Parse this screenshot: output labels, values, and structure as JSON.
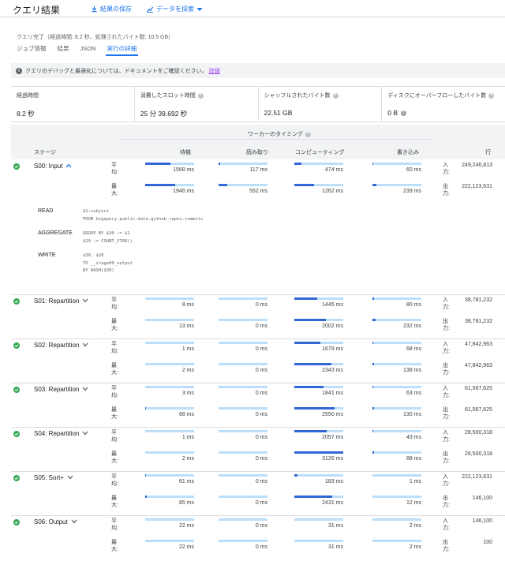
{
  "header": {
    "title": "クエリ結果",
    "save_label": "結果の保存",
    "explore_label": "データを探索"
  },
  "status": "クエリ完了（経過時間: 8.2 秒、処理されたバイト数: 10.5 GB）",
  "tabs": [
    {
      "label": "ジョブ情報"
    },
    {
      "label": "結果"
    },
    {
      "label": "JSON"
    },
    {
      "label": "実行の詳細",
      "active": true
    }
  ],
  "info": {
    "text": "クエリのデバッグと最適化については、ドキュメントをご確認ください。",
    "link": "詳細"
  },
  "metrics": [
    {
      "label": "経過時間",
      "value": "8.2 秒"
    },
    {
      "label": "消費したスロット時間",
      "value": "25 分 39.692 秒"
    },
    {
      "label": "シャッフルされたバイト数",
      "value": "22.51 GB"
    },
    {
      "label": "ディスクにオーバーフローしたバイト数",
      "value": "0 B"
    }
  ],
  "timing": {
    "title": "ワーカーのタイミング",
    "col_stage": "ステージ",
    "col_wait": "待機",
    "col_read": "読み取り",
    "col_compute": "コンピューティング",
    "col_write": "書き込み",
    "col_rows": "行",
    "avg_label": "平均:",
    "max_label": "最大:",
    "in_label": "入力:",
    "out_label": "出力:"
  },
  "stages": [
    {
      "name": "S00: Input",
      "expanded": true,
      "avg": {
        "wait": "1568 ms",
        "read": "117 ms",
        "compute": "474 ms",
        "write": "60 ms"
      },
      "max": {
        "wait": "1946 ms",
        "read": "552 ms",
        "compute": "1262 ms",
        "write": "239 ms"
      },
      "avg_fill": {
        "wait": 0.51,
        "read": 0.04,
        "compute": 0.15,
        "write": 0.02
      },
      "max_fill": {
        "wait": 0.62,
        "read": 0.18,
        "compute": 0.4,
        "write": 0.08
      },
      "rows_in": "249,246,813",
      "rows_out": "222,123,631",
      "steps": [
        {
          "label": "READ",
          "detail": "$1:subject\nFROM bigquery-public-data.github_repos.commits"
        },
        {
          "label": "AGGREGATE",
          "detail": "GROUP BY $30 := $1\n$20 := COUNT_STAR()"
        },
        {
          "label": "WRITE",
          "detail": "$30, $20\nTO __stage00_output\nBY HASH($30)"
        }
      ]
    },
    {
      "name": "S01: Repartition",
      "avg": {
        "wait": "8 ms",
        "read": "0 ms",
        "compute": "1445 ms",
        "write": "80 ms"
      },
      "max": {
        "wait": "13 ms",
        "read": "0 ms",
        "compute": "2002 ms",
        "write": "232 ms"
      },
      "avg_fill": {
        "wait": 0.0,
        "read": 0.0,
        "compute": 0.46,
        "write": 0.03
      },
      "max_fill": {
        "wait": 0.0,
        "read": 0.0,
        "compute": 0.64,
        "write": 0.07
      },
      "rows_in": "38,781,232",
      "rows_out": "38,781,232"
    },
    {
      "name": "S02: Repartition",
      "avg": {
        "wait": "1 ms",
        "read": "0 ms",
        "compute": "1679 ms",
        "write": "68 ms"
      },
      "max": {
        "wait": "2 ms",
        "read": "0 ms",
        "compute": "2343 ms",
        "write": "138 ms"
      },
      "avg_fill": {
        "wait": 0.0,
        "read": 0.0,
        "compute": 0.54,
        "write": 0.02
      },
      "max_fill": {
        "wait": 0.0,
        "read": 0.0,
        "compute": 0.75,
        "write": 0.04
      },
      "rows_in": "47,842,963",
      "rows_out": "47,842,963"
    },
    {
      "name": "S03: Repartition",
      "avg": {
        "wait": "3 ms",
        "read": "0 ms",
        "compute": "1841 ms",
        "write": "63 ms"
      },
      "max": {
        "wait": "68 ms",
        "read": "0 ms",
        "compute": "2550 ms",
        "write": "130 ms"
      },
      "avg_fill": {
        "wait": 0.0,
        "read": 0.0,
        "compute": 0.59,
        "write": 0.02
      },
      "max_fill": {
        "wait": 0.02,
        "read": 0.0,
        "compute": 0.82,
        "write": 0.04
      },
      "rows_in": "61,567,625",
      "rows_out": "61,567,625"
    },
    {
      "name": "S04: Repartition",
      "avg": {
        "wait": "1 ms",
        "read": "0 ms",
        "compute": "2057 ms",
        "write": "43 ms"
      },
      "max": {
        "wait": "2 ms",
        "read": "0 ms",
        "compute": "3126 ms",
        "write": "88 ms"
      },
      "avg_fill": {
        "wait": 0.0,
        "read": 0.0,
        "compute": 0.66,
        "write": 0.01
      },
      "max_fill": {
        "wait": 0.0,
        "read": 0.0,
        "compute": 1.0,
        "write": 0.03
      },
      "rows_in": "28,500,318",
      "rows_out": "28,500,318"
    },
    {
      "name": "S05: Sort+",
      "avg": {
        "wait": "61 ms",
        "read": "0 ms",
        "compute": "183 ms",
        "write": "1 ms"
      },
      "max": {
        "wait": "85 ms",
        "read": "0 ms",
        "compute": "2431 ms",
        "write": "12 ms"
      },
      "avg_fill": {
        "wait": 0.02,
        "read": 0.0,
        "compute": 0.06,
        "write": 0.0
      },
      "max_fill": {
        "wait": 0.03,
        "read": 0.0,
        "compute": 0.78,
        "write": 0.0
      },
      "rows_in": "222,123,631",
      "rows_out": "146,100"
    },
    {
      "name": "S06: Output",
      "avg": {
        "wait": "22 ms",
        "read": "0 ms",
        "compute": "31 ms",
        "write": "2 ms"
      },
      "max": {
        "wait": "22 ms",
        "read": "0 ms",
        "compute": "31 ms",
        "write": "2 ms"
      },
      "avg_fill": {
        "wait": 0.0,
        "read": 0.0,
        "compute": 0.0,
        "write": 0.0
      },
      "max_fill": {
        "wait": 0.0,
        "read": 0.0,
        "compute": 0.0,
        "write": 0.0
      },
      "rows_in": "146,100",
      "rows_out": "100"
    }
  ],
  "colors": {
    "accent": "#1a73e8",
    "bar_bg": "#bbdefb",
    "bar_fill": "#3367d6",
    "check": "#34a853"
  }
}
